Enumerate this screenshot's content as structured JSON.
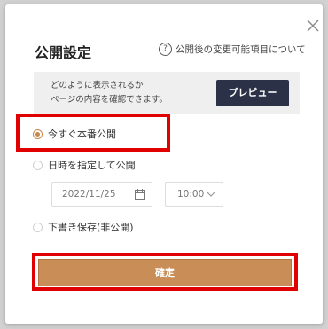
{
  "dialog": {
    "title": "公開設定",
    "help_link": "公開後の変更可能項目について",
    "info": {
      "line1": "どのように表示されるか",
      "line2": "ページの内容を確認できます。",
      "preview_button": "プレビュー"
    },
    "options": [
      {
        "label": "今すぐ本番公開",
        "checked": true
      },
      {
        "label": "日時を指定して公開",
        "checked": false
      },
      {
        "label": "下書き保存(非公開)",
        "checked": false
      }
    ],
    "date_value": "2022/11/25",
    "time_value": "10:00",
    "confirm_button": "確定"
  },
  "colors": {
    "accent": "#c98e57",
    "preview_button": "#2b3147",
    "highlight": "#e00000"
  },
  "icons": {
    "close": "close-icon",
    "help": "question-circle-icon",
    "calendar": "calendar-icon",
    "chevron": "chevron-down-icon"
  }
}
